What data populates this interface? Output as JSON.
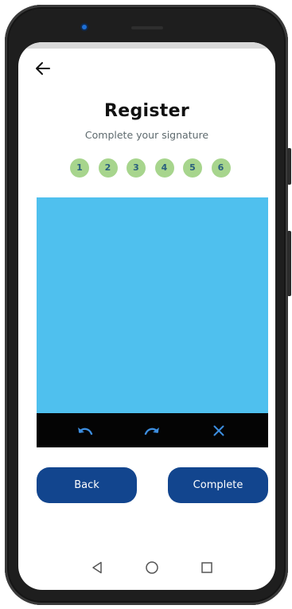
{
  "header": {
    "back_icon": "arrow-left-icon"
  },
  "page": {
    "title": "Register",
    "subtitle": "Complete your signature"
  },
  "steps": [
    "1",
    "2",
    "3",
    "4",
    "5",
    "6"
  ],
  "signature_pad": {
    "tools": [
      "undo-icon",
      "redo-icon",
      "clear-icon"
    ]
  },
  "actions": {
    "back_label": "Back",
    "complete_label": "Complete"
  },
  "system_nav": [
    "back-triangle-icon",
    "home-circle-icon",
    "recents-square-icon"
  ],
  "colors": {
    "pad": "#4fc0ee",
    "toolbar": "#040404",
    "button": "#12458e",
    "step": "#a7d58d",
    "tool_icon": "#3d8ee0"
  }
}
